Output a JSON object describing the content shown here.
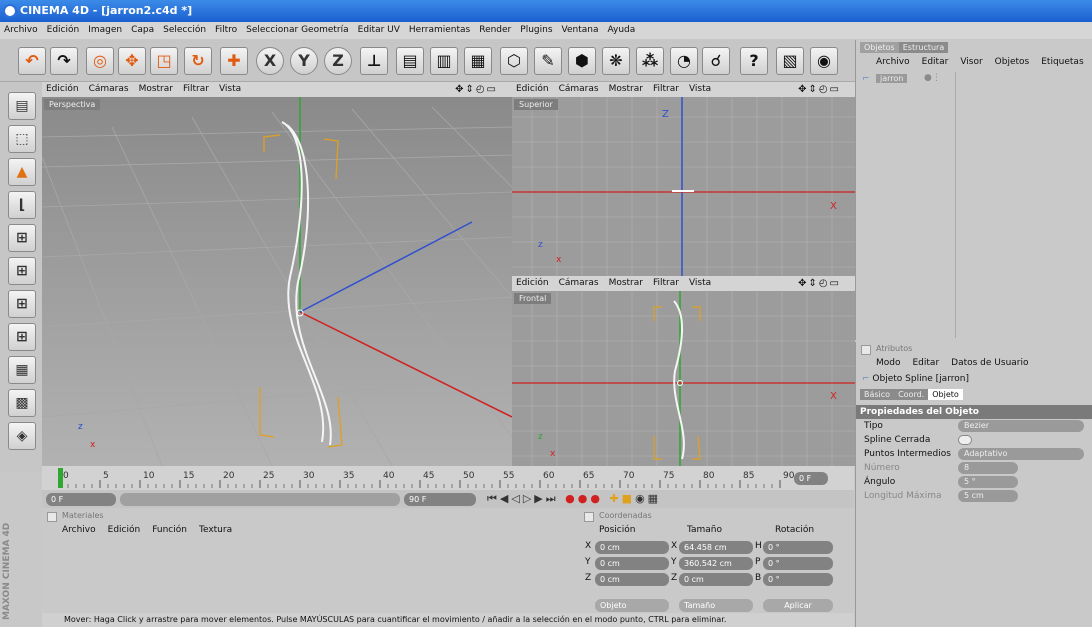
{
  "app": {
    "title": "CINEMA 4D - [jarron2.c4d *]"
  },
  "menu": [
    "Archivo",
    "Edición",
    "Imagen",
    "Capa",
    "Selección",
    "Filtro",
    "Seleccionar Geometría",
    "Editar UV",
    "Herramientas",
    "Render",
    "Plugins",
    "Ventana",
    "Ayuda"
  ],
  "toolbar": {
    "buttons": [
      {
        "name": "undo-icon",
        "glyph": "↶"
      },
      {
        "name": "redo-icon",
        "glyph": "↷"
      },
      {
        "name": "live-selection-icon",
        "glyph": "◎"
      },
      {
        "name": "move-icon",
        "glyph": "✥"
      },
      {
        "name": "scale-icon",
        "glyph": "◳"
      },
      {
        "name": "rotate-icon",
        "glyph": "↻"
      },
      {
        "name": "world-axis-icon",
        "glyph": "✚"
      },
      {
        "name": "x-axis-icon",
        "glyph": "X"
      },
      {
        "name": "y-axis-icon",
        "glyph": "Y"
      },
      {
        "name": "z-axis-icon",
        "glyph": "Z"
      },
      {
        "name": "coordinate-system-icon",
        "glyph": "⊥"
      },
      {
        "name": "render-view-icon",
        "glyph": "▤"
      },
      {
        "name": "render-picture-viewer-icon",
        "glyph": "▥"
      },
      {
        "name": "render-settings-icon",
        "glyph": "▦"
      },
      {
        "name": "cube-icon",
        "glyph": "⬡"
      },
      {
        "name": "spline-pen-icon",
        "glyph": "✎"
      },
      {
        "name": "nurbs-icon",
        "glyph": "⬢"
      },
      {
        "name": "array-icon",
        "glyph": "❋"
      },
      {
        "name": "deformer-icon",
        "glyph": "⁂"
      },
      {
        "name": "scene-icon",
        "glyph": "◔"
      },
      {
        "name": "camera-icon",
        "glyph": "☌"
      },
      {
        "name": "help-pointer-icon",
        "glyph": "?"
      },
      {
        "name": "layout-icon",
        "glyph": "▧"
      },
      {
        "name": "render-active-icon",
        "glyph": "◉"
      }
    ]
  },
  "left_tools": [
    {
      "name": "model-mode-icon",
      "glyph": "▤"
    },
    {
      "name": "object-mode-icon",
      "glyph": "⬚"
    },
    {
      "name": "points-mode-icon",
      "glyph": "▲"
    },
    {
      "name": "edges-mode-icon",
      "glyph": "⌊"
    },
    {
      "name": "polygons-mode-icon",
      "glyph": "⊞"
    },
    {
      "name": "uv-points-icon",
      "glyph": "⊞"
    },
    {
      "name": "uv-polygons-icon",
      "glyph": "⊞"
    },
    {
      "name": "axis-mode-icon",
      "glyph": "⊞"
    },
    {
      "name": "texture-mode-icon",
      "glyph": "▦"
    },
    {
      "name": "workplane-icon",
      "glyph": "▩"
    },
    {
      "name": "tweak-mode-icon",
      "glyph": "◈"
    }
  ],
  "viewport_menu": [
    "Edición",
    "Cámaras",
    "Mostrar",
    "Filtrar",
    "Vista"
  ],
  "viewports": {
    "perspective": "Perspectiva",
    "top": "Superior",
    "front": "Frontal"
  },
  "timeline": {
    "ticks": [
      "0",
      "5",
      "10",
      "15",
      "20",
      "25",
      "30",
      "35",
      "40",
      "45",
      "50",
      "55",
      "60",
      "65",
      "70",
      "75",
      "80",
      "85",
      "90"
    ],
    "current_frame": "0 F",
    "start_field": "0 F",
    "end_field": "90 F",
    "end_frame": "90 F"
  },
  "materials": {
    "title": "Materiales",
    "menu": [
      "Archivo",
      "Edición",
      "Función",
      "Textura"
    ]
  },
  "coordinates": {
    "title": "Coordenadas",
    "headers": [
      "Posición",
      "Tamaño",
      "Rotación"
    ],
    "rows": [
      {
        "axis": "X",
        "pos": "0 cm",
        "size_axis": "X",
        "size": "64.458 cm",
        "rot_axis": "H",
        "rot": "0 °"
      },
      {
        "axis": "Y",
        "pos": "0 cm",
        "size_axis": "Y",
        "size": "360.542 cm",
        "rot_axis": "P",
        "rot": "0 °"
      },
      {
        "axis": "Z",
        "pos": "0 cm",
        "size_axis": "Z",
        "size": "0 cm",
        "rot_axis": "B",
        "rot": "0 °"
      }
    ],
    "object_dd": "Objeto",
    "size_dd": "Tamaño",
    "apply": "Aplicar"
  },
  "status": "Mover: Haga Click y arrastre para mover elementos. Pulse MAYÚSCULAS para cuantificar el movimiento / añadir a la selección en el modo punto, CTRL para eliminar.",
  "brand": "MAXON CINEMA 4D",
  "objects": {
    "tabs": [
      "Objetos",
      "Estructura"
    ],
    "menu": [
      "Archivo",
      "Editar",
      "Visor",
      "Objetos",
      "Etiquetas"
    ],
    "item": "jarron"
  },
  "attributes": {
    "title": "Atributos",
    "menu": [
      "Modo",
      "Editar",
      "Datos de Usuario"
    ],
    "object_label": "Objeto Spline [jarron]",
    "tabs": [
      "Básico",
      "Coord.",
      "Objeto"
    ],
    "section": "Propiedades del Objeto",
    "props": [
      {
        "label": "Tipo",
        "value": "Bezier"
      },
      {
        "label": "Spline Cerrada",
        "value": ""
      },
      {
        "label": "Puntos Intermedios",
        "value": "Adaptativo"
      },
      {
        "label": "Número",
        "value": "8"
      },
      {
        "label": "Ángulo",
        "value": "5 °"
      },
      {
        "label": "Longitud Máxima",
        "value": "5 cm"
      }
    ]
  }
}
